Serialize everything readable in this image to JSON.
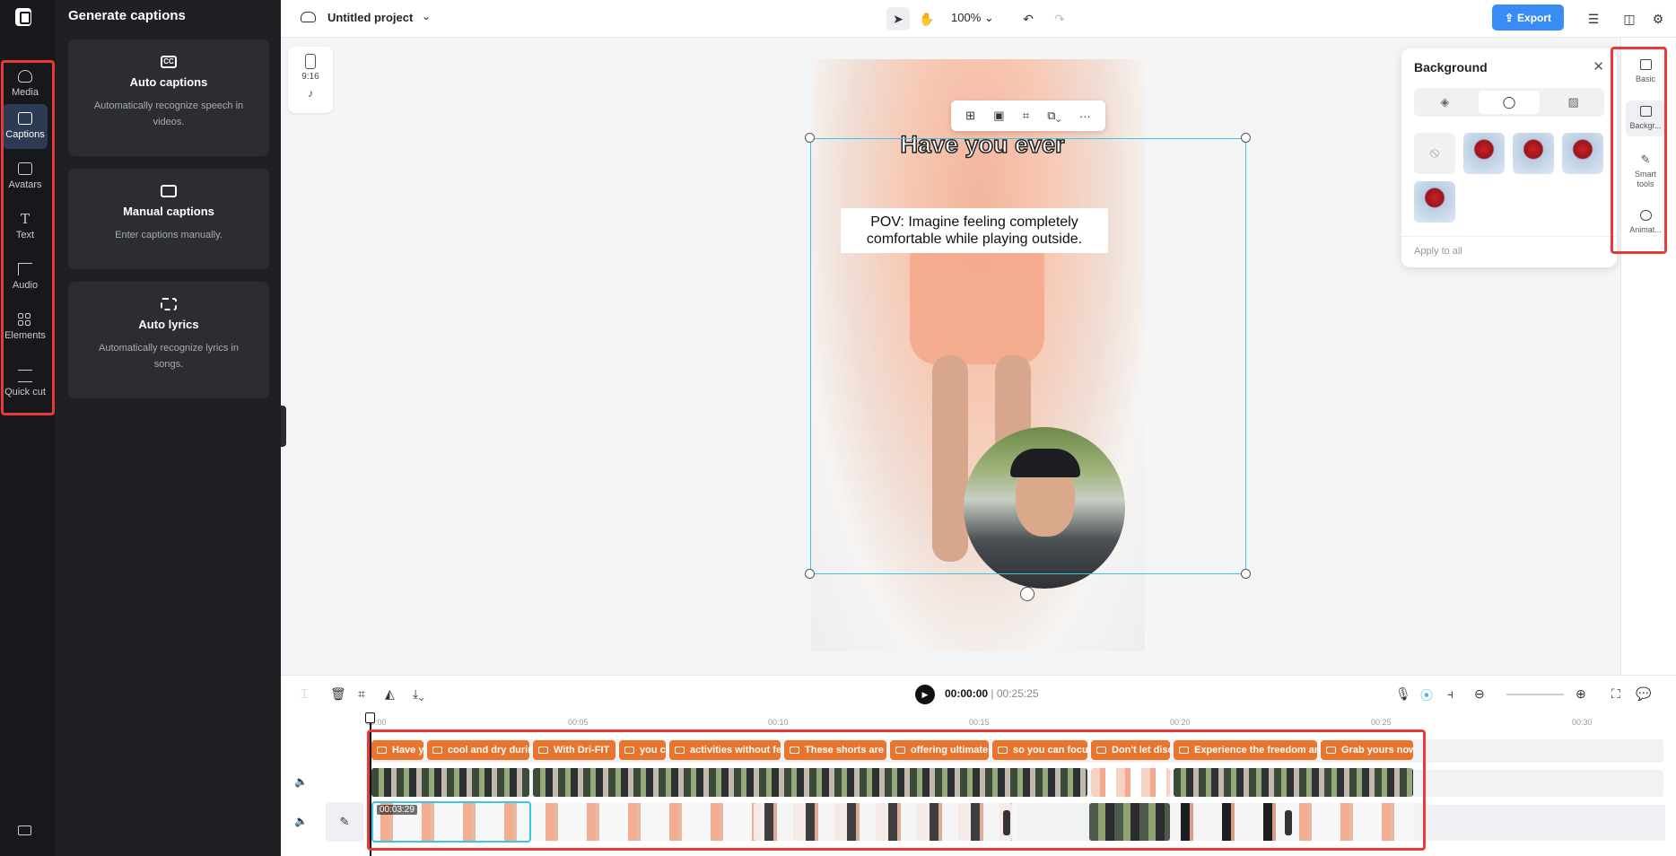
{
  "rail": {
    "items": [
      {
        "label": "Media",
        "icon": "cloud-upload-icon"
      },
      {
        "label": "Captions",
        "icon": "captions-icon"
      },
      {
        "label": "Avatars",
        "icon": "avatar-icon"
      },
      {
        "label": "Text",
        "icon": "text-icon"
      },
      {
        "label": "Audio",
        "icon": "audio-icon"
      },
      {
        "label": "Elements",
        "icon": "elements-icon"
      },
      {
        "label": "Quick cut",
        "icon": "quick-cut-icon"
      }
    ],
    "active": "Captions"
  },
  "panel": {
    "title": "Generate captions",
    "cards": [
      {
        "title": "Auto captions",
        "desc": "Automatically recognize speech in videos.",
        "icon": "cc-icon"
      },
      {
        "title": "Manual captions",
        "desc": "Enter captions manually.",
        "icon": "keyboard-icon"
      },
      {
        "title": "Auto lyrics",
        "desc": "Automatically recognize lyrics in songs.",
        "icon": "music-note-icon"
      }
    ]
  },
  "topbar": {
    "project_name": "Untitled project",
    "zoom": "100%",
    "export_label": "Export"
  },
  "canvas": {
    "ratio_label": "9:16",
    "caption_top": "Have you ever",
    "caption_pov": "POV: Imagine feeling completely comfortable while playing outside."
  },
  "background_panel": {
    "title": "Background",
    "apply_all": "Apply to all"
  },
  "right_tabs": [
    {
      "label": "Basic",
      "icon": "image-icon"
    },
    {
      "label": "Backgr...",
      "icon": "background-icon"
    },
    {
      "label": "Smart tools",
      "icon": "magic-wand-icon"
    },
    {
      "label": "Animat...",
      "icon": "animation-icon"
    }
  ],
  "timeline": {
    "current_time": "00:00:00",
    "duration": "00:25:25",
    "ruler": [
      "00:00",
      "00:05",
      "00:10",
      "00:15",
      "00:20",
      "00:25",
      "00:30"
    ],
    "clip_time": "00:03:29",
    "caption_chips": [
      "Have you ever",
      "cool and dry during",
      "With Dri-FIT",
      "you can",
      "activities without feeling",
      "These shorts are",
      "offering ultimate",
      "so you can focus",
      "Don't let discomfort",
      "Experience the freedom and",
      "Grab yours now"
    ]
  },
  "colors": {
    "accent": "#3a8cf5",
    "highlight_box": "#e83a3a",
    "caption_chip": "#e8742e",
    "selection": "#3cc5e6"
  }
}
